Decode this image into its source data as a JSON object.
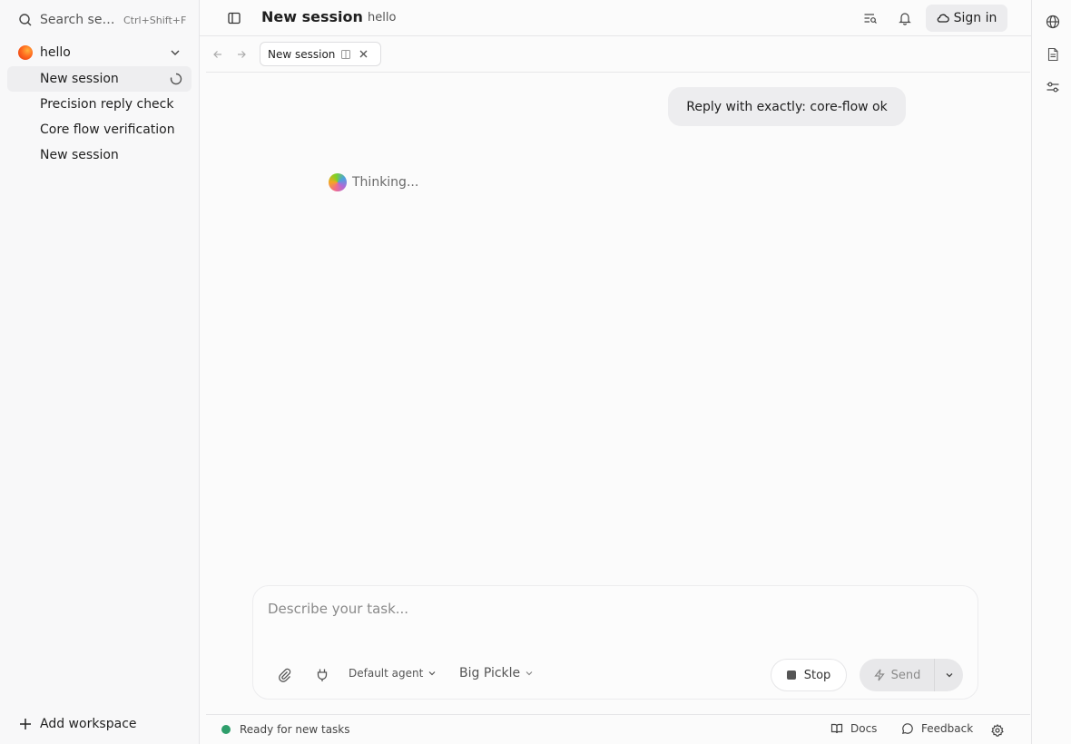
{
  "sidebar": {
    "search_label": "Search sessions",
    "search_shortcut": "Ctrl+Shift+F",
    "workspace": {
      "name": "hello",
      "color": "#ff6a1f"
    },
    "sessions": [
      {
        "label": "New session",
        "active": true,
        "loading": true
      },
      {
        "label": "Precision reply check"
      },
      {
        "label": "Core flow verification"
      },
      {
        "label": "New session"
      }
    ],
    "add_workspace_label": "Add workspace"
  },
  "header": {
    "title": "New session",
    "subtitle": "hello",
    "sign_in_label": "Sign in"
  },
  "tabs": [
    {
      "label": "New session"
    }
  ],
  "chat": {
    "user_message": "Reply with exactly: core-flow ok",
    "thinking_label": "Thinking..."
  },
  "composer": {
    "placeholder": "Describe your task...",
    "agent_label": "Default agent",
    "model_label": "Big Pickle",
    "stop_label": "Stop",
    "send_label": "Send"
  },
  "status": {
    "text": "Ready for new tasks",
    "dot_color": "#2e9e6b",
    "docs_label": "Docs",
    "feedback_label": "Feedback"
  },
  "icons": {
    "search": "search-icon",
    "chevron": "chevron-down-icon",
    "spinner": "spinner-icon",
    "plus": "plus-icon",
    "sidebar_toggle": "sidebar-toggle-icon",
    "session_search": "list-search-icon",
    "bell": "bell-icon",
    "cloud": "cloud-icon",
    "globe": "globe-icon",
    "file": "file-icon",
    "sliders": "sliders-icon",
    "paperclip": "paperclip-icon",
    "plug": "plug-icon",
    "bolt": "bolt-icon",
    "book": "book-icon",
    "chat": "chat-bubble-icon",
    "gear": "gear-icon"
  }
}
